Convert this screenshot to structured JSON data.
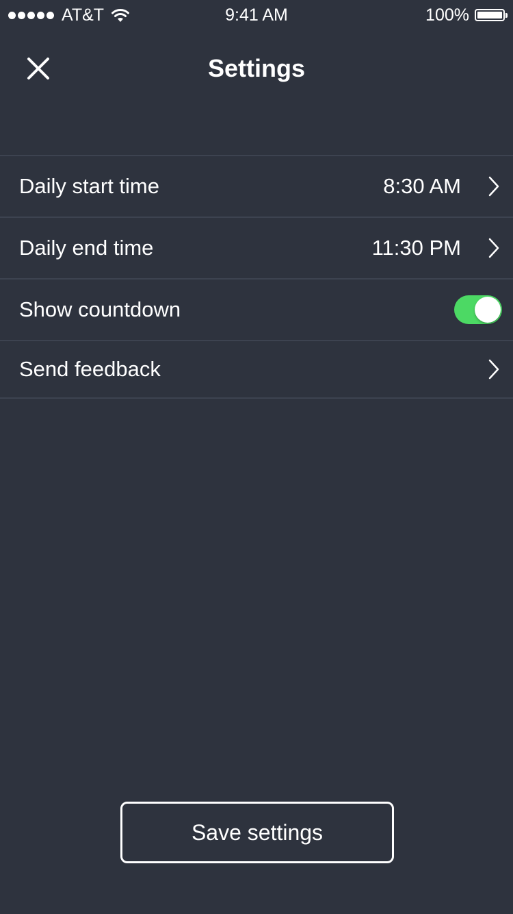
{
  "status_bar": {
    "carrier": "AT&T",
    "time": "9:41 AM",
    "battery": "100%",
    "signal_bars": 5,
    "battery_level": 1.0
  },
  "header": {
    "title": "Settings",
    "close_icon": "close-icon"
  },
  "settings": {
    "start_time": {
      "label": "Daily start time",
      "value": "8:30 AM"
    },
    "end_time": {
      "label": "Daily end time",
      "value": "11:30 PM"
    },
    "countdown": {
      "label": "Show countdown",
      "enabled": true
    },
    "feedback": {
      "label": "Send feedback"
    }
  },
  "footer": {
    "save_label": "Save settings"
  },
  "colors": {
    "background": "#2e333e",
    "divider": "#3d4350",
    "toggle_on": "#4cd964",
    "text": "#ffffff"
  }
}
